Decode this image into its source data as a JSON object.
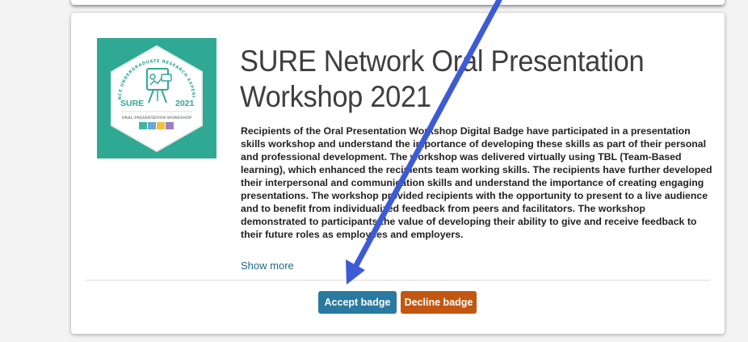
{
  "badge": {
    "title": "SURE Network Oral Presentation Workshop 2021",
    "description": "Recipients of the Oral Presentation Workshop Digital Badge have participated in a presentation skills workshop and understand the importance of developing these skills as part of their personal and professional development. The workshop was delivered virtually using TBL (Team-Based learning), which enhanced the recipients team working skills. The recipients have further developed their interpersonal and communication skills and understand the importance of creating engaging presentations. The workshop provided recipients with the opportunity to present to a live audience and to benefit from individualized feedback from peers and facilitators. The workshop demonstrated to participants the value of developing their ability to give and receive feedback to their future roles as employees and employers.",
    "show_more_label": "Show more",
    "image": {
      "arc_text": "SCIENCE UNDERGRADUATE RESEARCH EXPERIENCE",
      "left_label": "SURE",
      "right_label": "2021",
      "bottom_label": "ORAL PRESENTATION WORKSHOP",
      "icon": "presentation-board-icon",
      "background_color": "#2fa993"
    }
  },
  "actions": {
    "accept_label": "Accept badge",
    "decline_label": "Decline badge",
    "accept_color": "#2979a0",
    "decline_color": "#c4570f"
  },
  "annotation": {
    "arrow_color": "#3e5bd6"
  }
}
